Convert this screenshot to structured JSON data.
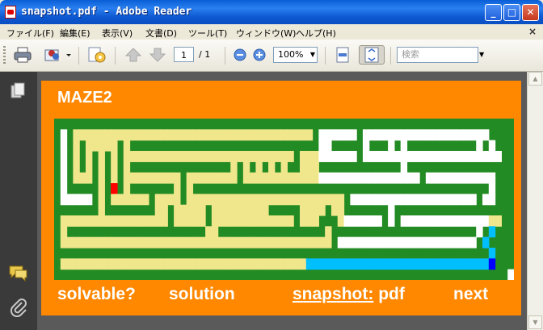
{
  "window": {
    "title": "snapshot.pdf - Adobe Reader",
    "buttons": {
      "minimize": "_",
      "maximize": "□",
      "close": "✕"
    }
  },
  "menu": [
    "ファイル(F)",
    "編集(E)",
    "表示(V)",
    "文書(D)",
    "ツール(T)",
    "ウィンドウ(W)",
    "ヘルプ(H)"
  ],
  "menu_close": "×",
  "toolbar": {
    "page_current": "1",
    "page_total": "/ 1",
    "zoom": "100%",
    "search_placeholder": "検索"
  },
  "page": {
    "title": "MAZE2",
    "links": {
      "solvable": "solvable?",
      "solution": "solution",
      "snapshot": "snapshot:",
      "pdf": "pdf",
      "next": "next"
    },
    "colors": {
      "background": "#ff8800",
      "wall": "#238b23",
      "explored": "#f0e68c",
      "open": "#ffffff",
      "path": "#00bfff",
      "start": "#ff0000",
      "goal": "#0000ff"
    }
  },
  "maze": {
    "legend": {
      "G": "wall",
      "Y": "explored",
      "W": "open",
      "C": "path",
      "R": "start",
      "B": "goal"
    },
    "rows": [
      "GGGGGGGGGGGGGGGGGGGGGGGGGGGGGGGGGGGGGGGGGGGGGGGGGGGGGGGGGGGGGGGGGGGGGGGGG",
      "GWGYYYYYYYYYYYYYYYYYYYYYYYYYYYYYYYYYYYYYYGWWWWWWGWWWWWWWWWWWWWWWWWWWWGGGG",
      "GWGYGYYYYYGYGGGGGGGGGGGGGGGGGGGGGGGGGGGGGGWWGGGGGWGGGWGWGGGGGGGGGGGWGWGGG",
      "GWGYGYGYGYGYYYYYYYYYYYYYYYYYYYYYYYYYYYGYYYWWWWWWGWWWWWWWWWWWWWWWWWWWWWWGG",
      "GWGYGYGYGYGYGGGGGGGGGGGGGGGGYGYGYGYGYGGYYYGGGGGGGGGGGGGWGGGGGGGGGGGGGGGGG",
      "GWGYYYGYGYGYYYYYYYYYGYYYYYYYYGYYYYYYYYYYYYWWWWWWWWWWWWWWWWGWWWWWWWWWWWGGG",
      "GWGGGGGYGRGYGGGGGGGYGYGGGGGGGGGGGGGGGGGGGGGGGGGGGGGGGGGGGGGGGGGGGGGGGWGGG",
      "GWWWWWGYGYYYYYYGYYYYGYYYYYYYYYYYYYYYYYYYYYYYYYGWWWWWWWWWWWWWWWWWWWWGWWGGG",
      "GGGGGGGYGGGGGGGGYYGYYYYYGYYYYYYYYYGGGGGYYYYGYYGGGGGGGWGGGGGGGGGGGGGGGGGGG",
      "GYYYYYYYYYYYYYYYYYGYYYYYGYYYYYYYYYYYYYGYYYGGGYWWWWWWGWGWWWWWWWWWWWWWWYYGG",
      "GYGGGGGGGGGGGGGGGGGGGGGGYYGGGGGGGGGGGGGGGGGYGGGGGGGGGGGGGGGGGGGGGGGWGCGG",
      "GYYYYYYYYYYYYYYYYYYYYYYYYYYYYYYYYYYYYYYYYYYYGWWWWWWWWWWWWWWWWWWWWWWGCGG",
      "GGGGGGGGGGGGGGGGGGGGGGGGGGGGGGGGGGGGGGGGGGGGGGGGGGGGGGGGGGGGGGGGGGGGGCGG",
      "GYYYYYYYYYYYYYYYYYYYYYYYYYYYYYYYYYYYYYYYCCCCCCCCCCCCCCCCCCCCCCCCCCCCCBG",
      "GGGGGGGGGGGGGGGGGGGGGGGGGGGGGGGGGGGGGGGGGGGGGGGGGGGGGGGGGGGGGGGGGGGGGGGGW"
    ]
  }
}
